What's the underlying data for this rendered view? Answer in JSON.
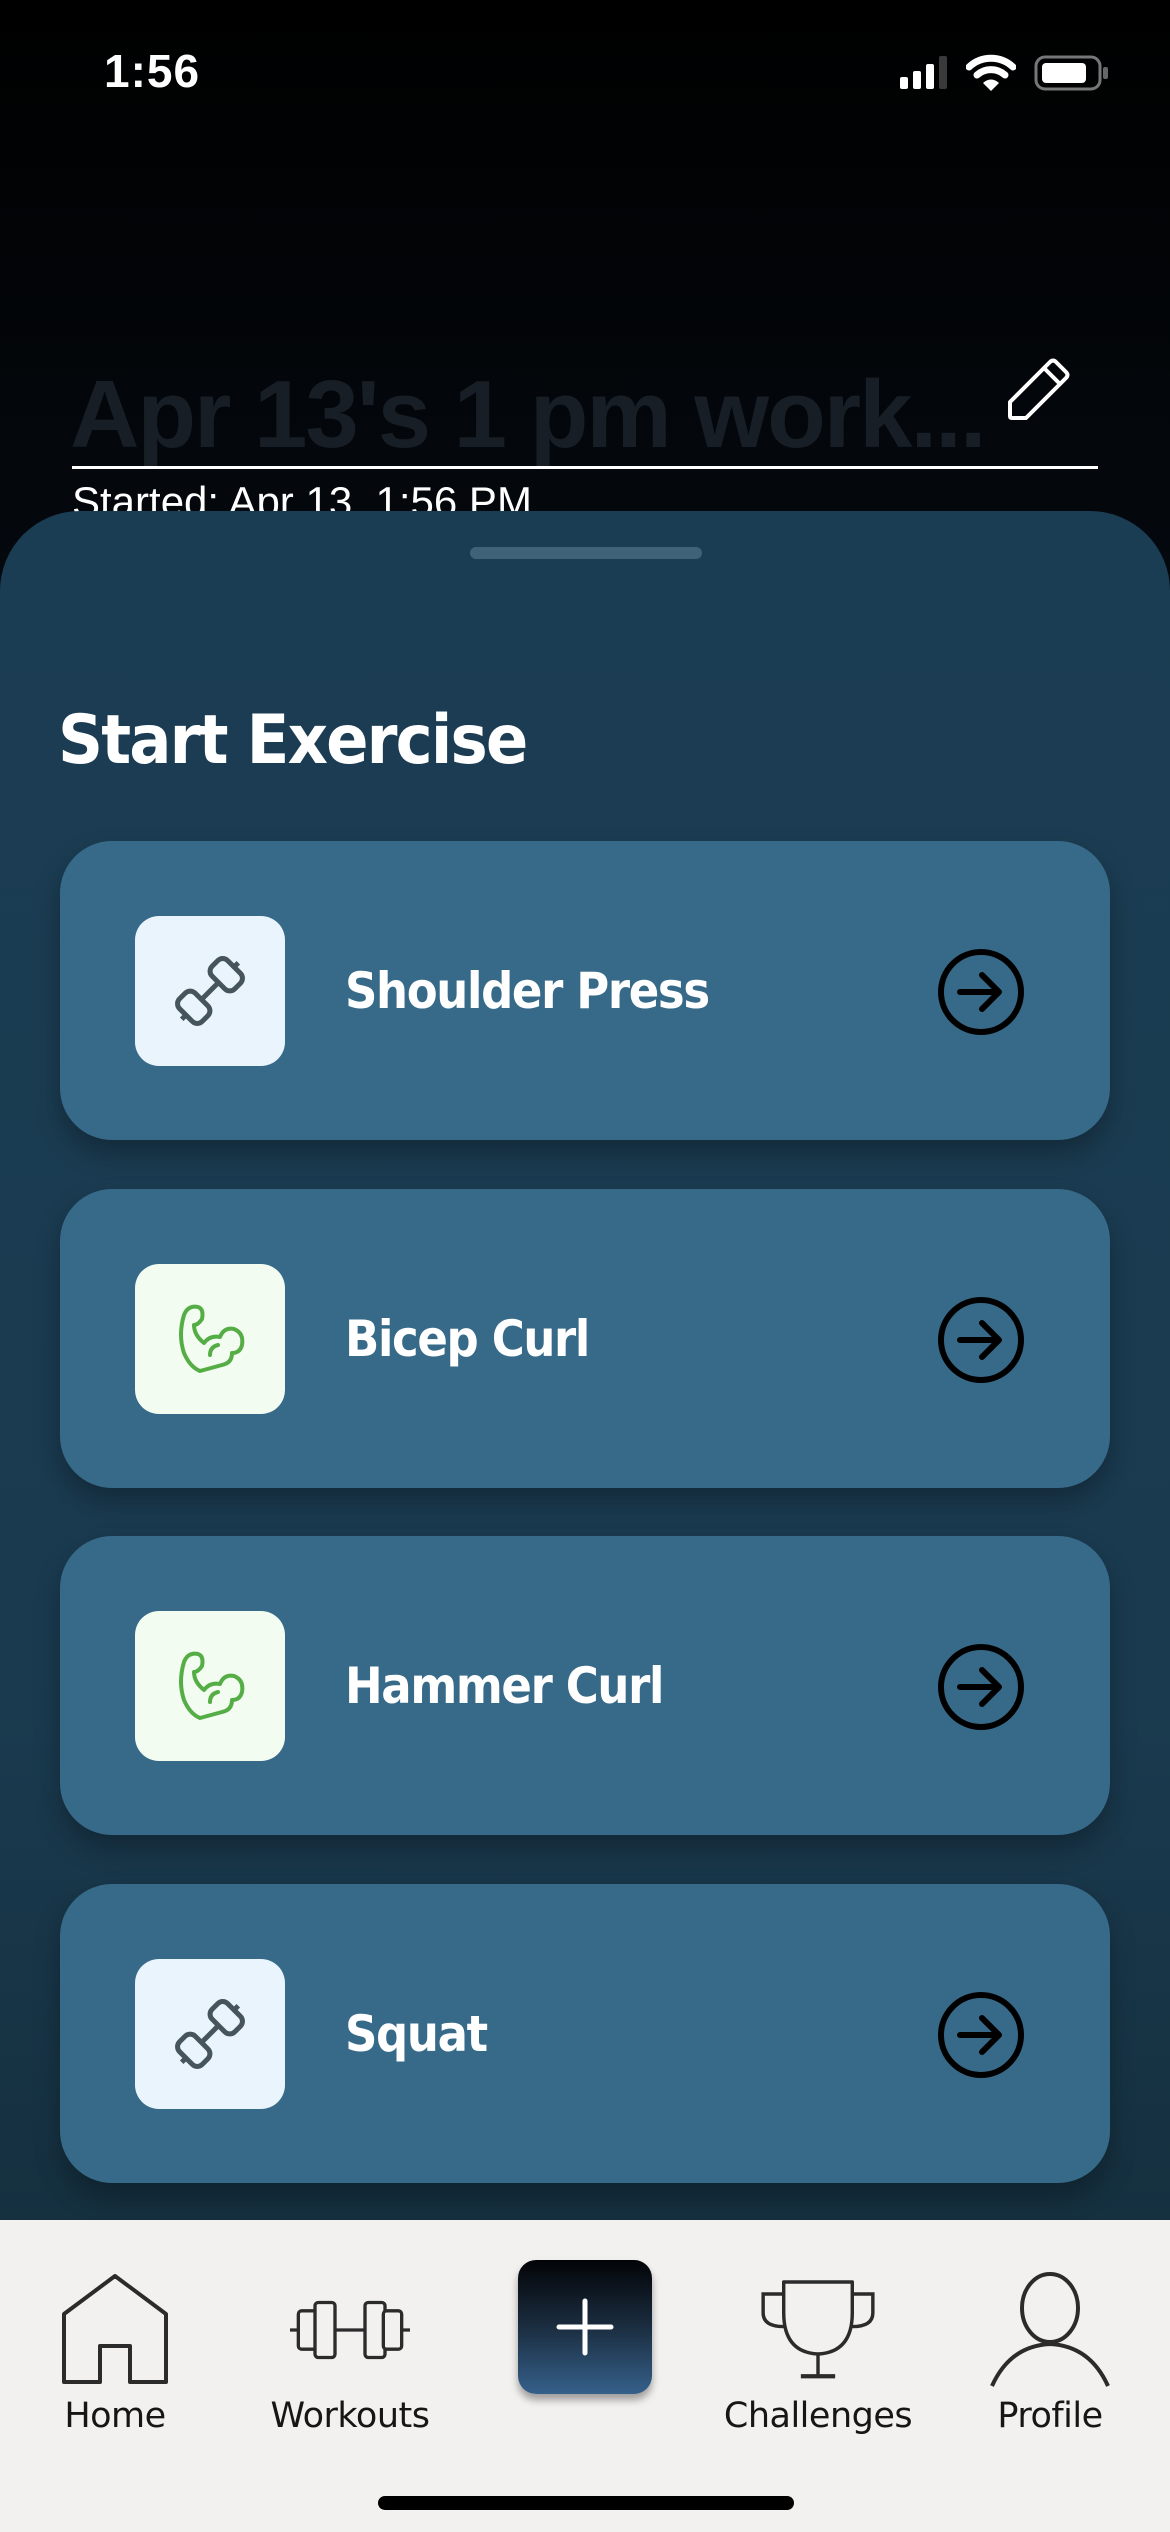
{
  "status_bar": {
    "time": "1:56",
    "icons": [
      "cellular-signal-icon",
      "wifi-icon",
      "battery-icon"
    ]
  },
  "workout": {
    "title": "Apr 13's 1 pm work...",
    "started": "Started: Apr 13, 1:56 PM",
    "edit_icon": "pencil-icon"
  },
  "sheet": {
    "title": "Start Exercise",
    "exercises": [
      {
        "name": "Shoulder Press",
        "icon": "dumbbell-icon",
        "icon_bg": "#eaf4fc",
        "icon_color": "#46545c"
      },
      {
        "name": "Bicep Curl",
        "icon": "flexed-bicep-icon",
        "icon_bg": "#f3fcf1",
        "icon_color": "#55ad45"
      },
      {
        "name": "Hammer Curl",
        "icon": "flexed-bicep-icon",
        "icon_bg": "#f3fcf1",
        "icon_color": "#55ad45"
      },
      {
        "name": "Squat",
        "icon": "dumbbell-icon",
        "icon_bg": "#eaf4fc",
        "icon_color": "#46545c"
      }
    ],
    "card_color": "#376a89",
    "arrow_icon": "arrow-right-circle-icon"
  },
  "tabbar": {
    "tabs": [
      {
        "label": "Home",
        "icon": "home-icon"
      },
      {
        "label": "Workouts",
        "icon": "barbell-icon"
      },
      {
        "label": "",
        "icon": "plus-icon"
      },
      {
        "label": "Challenges",
        "icon": "trophy-icon"
      },
      {
        "label": "Profile",
        "icon": "person-icon"
      }
    ]
  }
}
